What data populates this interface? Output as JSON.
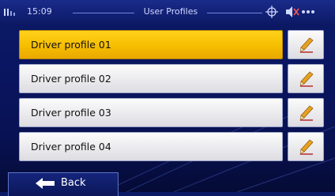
{
  "statusbar": {
    "time": "15:09",
    "title": "User Profiles"
  },
  "profiles": [
    {
      "label": "Driver profile 01",
      "selected": true
    },
    {
      "label": "Driver profile 02",
      "selected": false
    },
    {
      "label": "Driver profile 03",
      "selected": false
    },
    {
      "label": "Driver profile 04",
      "selected": false
    }
  ],
  "icons": {
    "signal": "signal-bars-icon",
    "gps": "gps-icon",
    "mute": "speaker-mute-icon",
    "menu": "menu-dots-icon",
    "edit": "pencil-icon",
    "back": "arrow-left-icon"
  },
  "footer": {
    "back_label": "Back"
  },
  "colors": {
    "background": "#0a1560",
    "selected_row": "#f6be00",
    "row": "#e9e9ec",
    "status_text": "#cfd8ff"
  }
}
